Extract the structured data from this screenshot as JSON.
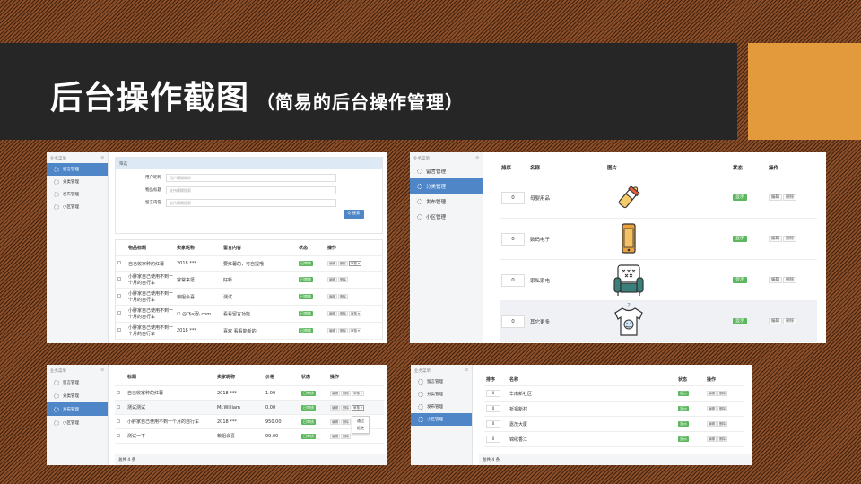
{
  "slide": {
    "title": "后台操作截图",
    "subtitle": "（简易的后台操作管理）",
    "colors": {
      "title_band": "#262626",
      "accent_block": "#e39a3c",
      "sidebar_active": "#4e86c8",
      "status_badge": "#5cb85c"
    }
  },
  "sidebar": {
    "header": "业务菜单",
    "collapse": "⊙",
    "items": [
      {
        "label": "留言管理",
        "icon": "gear-icon"
      },
      {
        "label": "分类管理",
        "icon": "gear-icon"
      },
      {
        "label": "发布管理",
        "icon": "gear-icon"
      },
      {
        "label": "小区管理",
        "icon": "gear-icon"
      }
    ]
  },
  "messages": {
    "filter_title": "筛选",
    "filters": [
      {
        "label": "用户昵称",
        "placeholder": "用户模糊昵称"
      },
      {
        "label": "物品标题",
        "placeholder": "支持模糊搜索"
      },
      {
        "label": "留言内容",
        "placeholder": "支持模糊搜索"
      }
    ],
    "search_button": "Q 搜索",
    "columns": [
      "物品标题",
      "卖家昵称",
      "留言内容",
      "状态",
      "操作"
    ],
    "rows": [
      {
        "title": "自己收家种的红薯",
        "seller": "2018 ***",
        "content": "要红薯的，可自提哦",
        "status": "已审核"
      },
      {
        "title": "小胖家自己使用不到一个月的自行车",
        "seller": "常常来逛",
        "content": "好新",
        "status": "已审核"
      },
      {
        "title": "小胖家自己使用不到一个月的自行车",
        "seller": "粮姐会喜",
        "content": "测试",
        "status": "已审核"
      },
      {
        "title": "小胖家自己使用不到一个月的自行车",
        "seller": "☐ @飞a酒\\.com",
        "content": "看看留言功能",
        "status": "已审核"
      },
      {
        "title": "小胖家自己使用不到一个月的自行车",
        "seller": "2018 ***",
        "content": "喜欢 看看能新的",
        "status": "已审核"
      }
    ],
    "actions": {
      "edit": "编辑",
      "delete": "删除",
      "review": "审核 ▾"
    },
    "dropdown": [
      "通过",
      "拒绝"
    ]
  },
  "categories": {
    "columns": [
      "排序",
      "名称",
      "图片",
      "状态",
      "操作"
    ],
    "rows": [
      {
        "order": "0",
        "name": "母婴用品",
        "status": "显示",
        "icon": "baby-bottle-icon"
      },
      {
        "order": "0",
        "name": "数码电子",
        "status": "显示",
        "icon": "smartphone-icon"
      },
      {
        "order": "0",
        "name": "家私家电",
        "status": "显示",
        "icon": "armchair-icon"
      },
      {
        "order": "0",
        "name": "其它更多",
        "status": "显示",
        "icon": "tshirt-icon"
      }
    ],
    "actions": {
      "edit": "编辑",
      "delete": "删除"
    }
  },
  "publish": {
    "columns": [
      "标题",
      "卖家昵称",
      "价格",
      "状态",
      "操作"
    ],
    "rows": [
      {
        "title": "自己收家种的红薯",
        "seller": "2018 ***",
        "price": "1.00",
        "status": "已审核"
      },
      {
        "title": "测试测试",
        "seller": "Mr.William",
        "price": "0.00",
        "status": "已审核"
      },
      {
        "title": "小胖家自己使用不到一个月的自行车",
        "seller": "2018 ***",
        "price": "950.00",
        "status": "已审核"
      },
      {
        "title": "测试一下",
        "seller": "粮姐会喜",
        "price": "99.00",
        "status": "已审核"
      }
    ],
    "actions": {
      "edit": "编辑",
      "delete": "删除",
      "review": "审核 ▾"
    },
    "dropdown": [
      "通过",
      "拒绝"
    ],
    "footer": "总共 4 条"
  },
  "communities": {
    "columns": [
      "排序",
      "名称",
      "状态",
      "操作"
    ],
    "rows": [
      {
        "order": "0",
        "name": "华南新社区",
        "status": "显示"
      },
      {
        "order": "0",
        "name": "祈福新村",
        "status": "显示"
      },
      {
        "order": "0",
        "name": "嘉茂大厦",
        "status": "显示"
      },
      {
        "order": "0",
        "name": "锦绣香江",
        "status": "显示"
      }
    ],
    "actions": {
      "edit": "编辑",
      "delete": "删除"
    },
    "footer": "总共 4 条"
  }
}
